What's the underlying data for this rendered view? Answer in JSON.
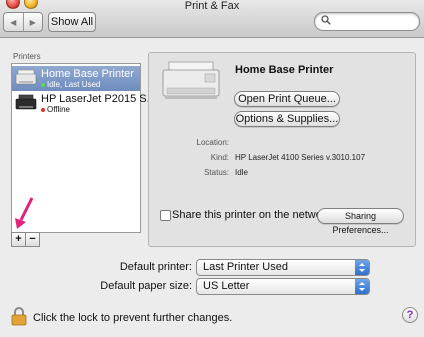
{
  "window": {
    "title": "Print & Fax"
  },
  "toolbar": {
    "back_icon": "chevron-left-icon",
    "forward_icon": "chevron-right-icon",
    "show_all_label": "Show All",
    "search_placeholder": ""
  },
  "printers_list": {
    "header": "Printers",
    "items": [
      {
        "name": "Home Base Printer",
        "status": "Idle, Last Used",
        "status_color": "#5cd65c",
        "selected": true
      },
      {
        "name": "HP LaserJet P2015 S...",
        "status": "Offline",
        "status_color": "#e0302a",
        "selected": false
      }
    ],
    "add_label": "+",
    "remove_label": "−"
  },
  "detail": {
    "printer_name": "Home Base Printer",
    "open_queue_label": "Open Print Queue...",
    "options_label": "Options & Supplies...",
    "location_label": "Location:",
    "location_value": "",
    "kind_label": "Kind:",
    "kind_value": "HP LaserJet 4100 Series v.3010.107",
    "status_label": "Status:",
    "status_value": "Idle",
    "share_label": "Share this printer on the network",
    "share_checked": false,
    "sharing_prefs_label": "Sharing Preferences..."
  },
  "defaults": {
    "printer_label": "Default printer:",
    "printer_value": "Last Printer Used",
    "paper_label": "Default paper size:",
    "paper_value": "US Letter"
  },
  "footer": {
    "lock_text": "Click the lock to prevent further changes.",
    "help_label": "?"
  },
  "colors": {
    "selection": "#7f99c7",
    "accent_popup": "#3a78d4",
    "annotation_arrow": "#e0237b"
  }
}
